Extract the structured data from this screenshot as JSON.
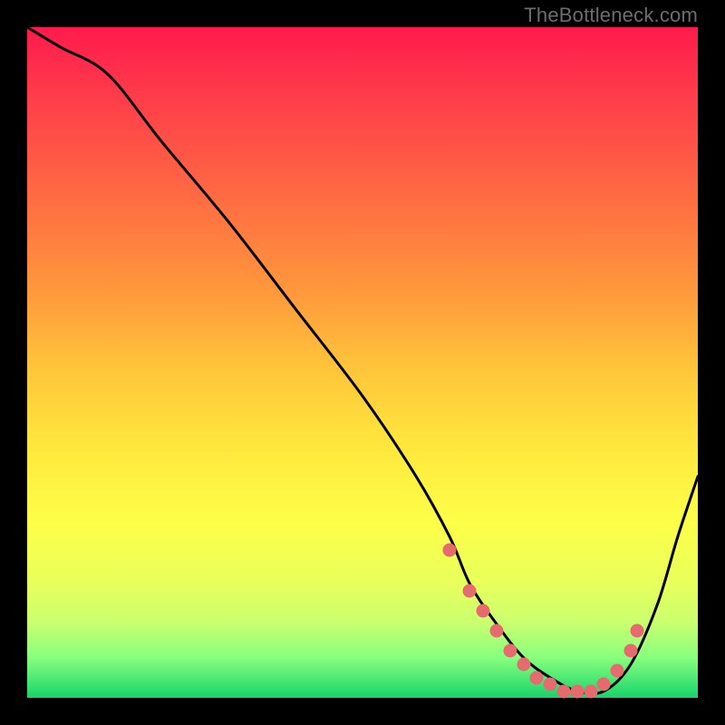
{
  "attribution": "TheBottleneck.com",
  "colors": {
    "marker": "#e76a6e",
    "curve": "#000000",
    "frame": "#000000"
  },
  "chart_data": {
    "type": "line",
    "title": "",
    "xlabel": "",
    "ylabel": "",
    "xlim": [
      0,
      100
    ],
    "ylim": [
      0,
      100
    ],
    "grid": false,
    "legend": false,
    "series": [
      {
        "name": "bottleneck-curve",
        "x": [
          0,
          5,
          12,
          20,
          30,
          40,
          50,
          58,
          63,
          66,
          70,
          74,
          78,
          82,
          86,
          90,
          94,
          97,
          100
        ],
        "y": [
          100,
          97,
          93,
          83,
          71,
          58,
          45,
          33,
          24,
          17,
          11,
          6,
          3,
          1,
          1,
          5,
          14,
          24,
          33
        ]
      }
    ],
    "markers": {
      "name": "highlight-points",
      "x": [
        63,
        66,
        68,
        70,
        72,
        74,
        76,
        78,
        80,
        82,
        84,
        86,
        88,
        90,
        91
      ],
      "y": [
        22,
        16,
        13,
        10,
        7,
        5,
        3,
        2,
        1,
        1,
        1,
        2,
        4,
        7,
        10
      ]
    }
  }
}
